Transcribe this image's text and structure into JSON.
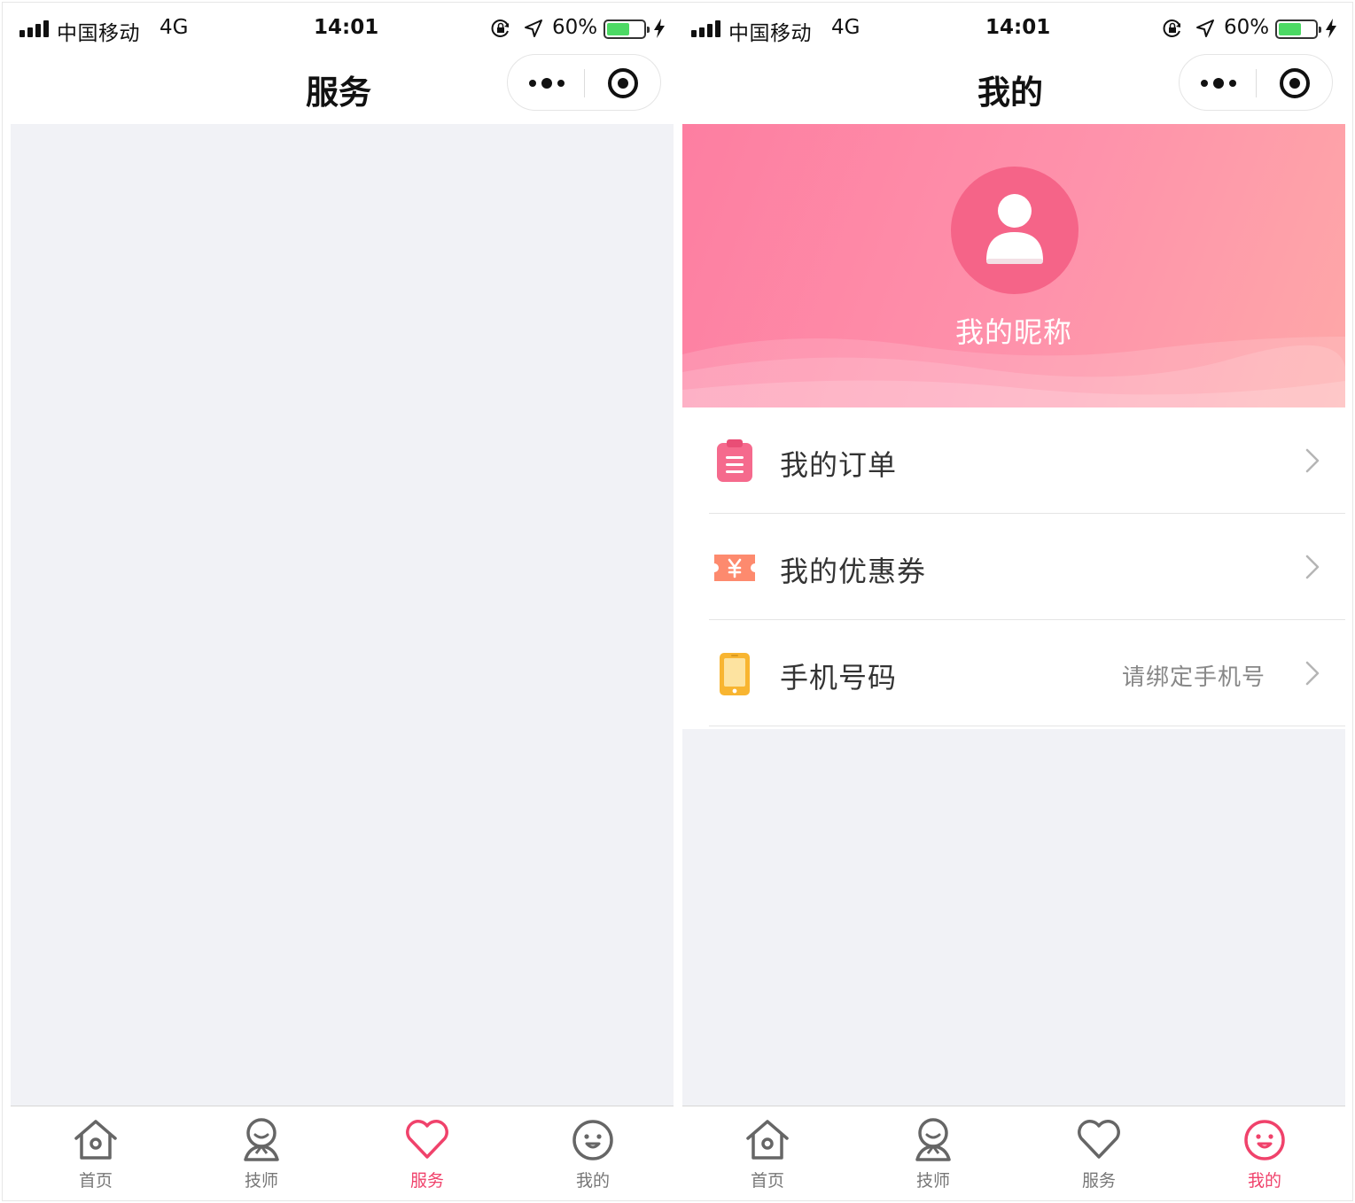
{
  "status_bar": {
    "carrier": "中国移动",
    "network": "4G",
    "time": "14:01",
    "battery_percent_text": "60%",
    "battery_level": 0.6,
    "icons": [
      "signal-icon",
      "orientation-lock-icon",
      "location-icon",
      "battery-icon",
      "charging-bolt-icon"
    ]
  },
  "colors": {
    "accent": "#f0426b",
    "inactive_tab": "#777777",
    "content_bg": "#f1f2f6",
    "header_gradient": [
      "#fd7ea1",
      "#fea8a8"
    ],
    "battery_fill": "#4cd964"
  },
  "left_screen": {
    "nav_title": "服务",
    "tabs": [
      {
        "label": "首页",
        "icon": "home-icon",
        "active": false
      },
      {
        "label": "技师",
        "icon": "technician-icon",
        "active": false
      },
      {
        "label": "服务",
        "icon": "heart-icon",
        "active": true
      },
      {
        "label": "我的",
        "icon": "smiley-icon",
        "active": false
      }
    ]
  },
  "right_screen": {
    "nav_title": "我的",
    "nickname": "我的昵称",
    "menu": [
      {
        "label": "我的订单",
        "value": "",
        "icon": "order-clipboard-icon"
      },
      {
        "label": "我的优惠券",
        "value": "",
        "icon": "coupon-ticket-icon"
      },
      {
        "label": "手机号码",
        "value": "请绑定手机号",
        "icon": "phone-icon"
      }
    ],
    "tabs": [
      {
        "label": "首页",
        "icon": "home-icon",
        "active": false
      },
      {
        "label": "技师",
        "icon": "technician-icon",
        "active": false
      },
      {
        "label": "服务",
        "icon": "heart-icon",
        "active": false
      },
      {
        "label": "我的",
        "icon": "smiley-icon",
        "active": true
      }
    ]
  }
}
